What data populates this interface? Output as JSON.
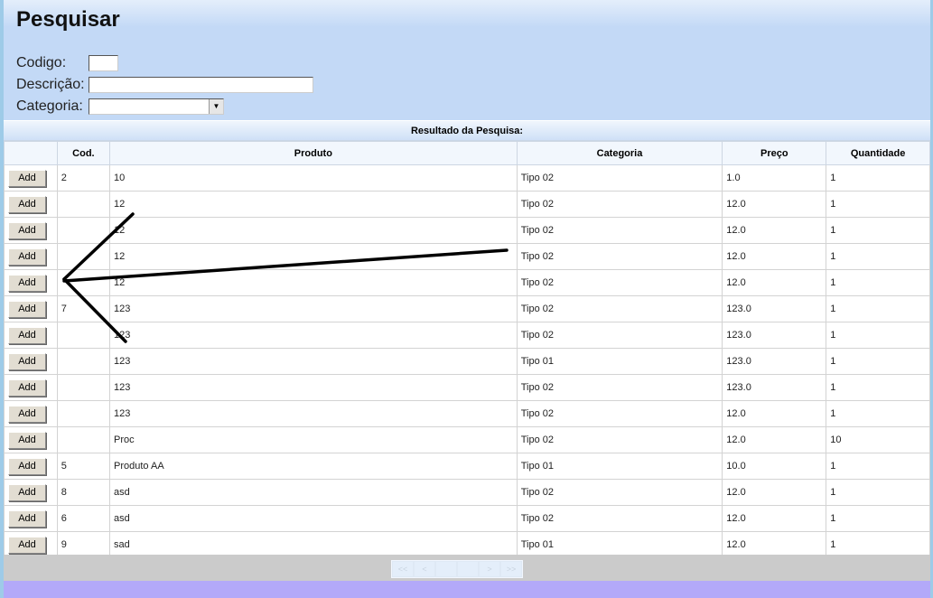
{
  "title": "Pesquisar",
  "form": {
    "codigo_label": "Codigo:",
    "descricao_label": "Descrição:",
    "categoria_label": "Categoria:",
    "codigo_value": "",
    "descricao_value": "",
    "categoria_value": ""
  },
  "results": {
    "title": "Resultado da Pesquisa:",
    "columns": [
      "",
      "Cod.",
      "Produto",
      "Categoria",
      "Preço",
      "Quantidade"
    ],
    "add_label": "Add",
    "rows": [
      [
        "2",
        "10",
        "Tipo 02",
        "1.0",
        "1"
      ],
      [
        "",
        "12",
        "Tipo 02",
        "12.0",
        "1"
      ],
      [
        "",
        "12",
        "Tipo 02",
        "12.0",
        "1"
      ],
      [
        "",
        "12",
        "Tipo 02",
        "12.0",
        "1"
      ],
      [
        "",
        "12",
        "Tipo 02",
        "12.0",
        "1"
      ],
      [
        "7",
        "123",
        "Tipo 02",
        "123.0",
        "1"
      ],
      [
        "",
        "123",
        "Tipo 02",
        "123.0",
        "1"
      ],
      [
        "",
        "123",
        "Tipo 01",
        "123.0",
        "1"
      ],
      [
        "",
        "123",
        "Tipo 02",
        "123.0",
        "1"
      ],
      [
        "",
        "123",
        "Tipo 02",
        "12.0",
        "1"
      ],
      [
        "",
        "Proc",
        "Tipo 02",
        "12.0",
        "10"
      ],
      [
        "5",
        "Produto AA",
        "Tipo 01",
        "10.0",
        "1"
      ],
      [
        "8",
        "asd",
        "Tipo 02",
        "12.0",
        "1"
      ],
      [
        "6",
        "asd",
        "Tipo 02",
        "12.0",
        "1"
      ],
      [
        "9",
        "sad",
        "Tipo 01",
        "12.0",
        "1"
      ]
    ]
  },
  "pager": {
    "first": "<<",
    "prev": "<",
    "page": "",
    "total": "",
    "next": ">",
    "last": ">>"
  }
}
